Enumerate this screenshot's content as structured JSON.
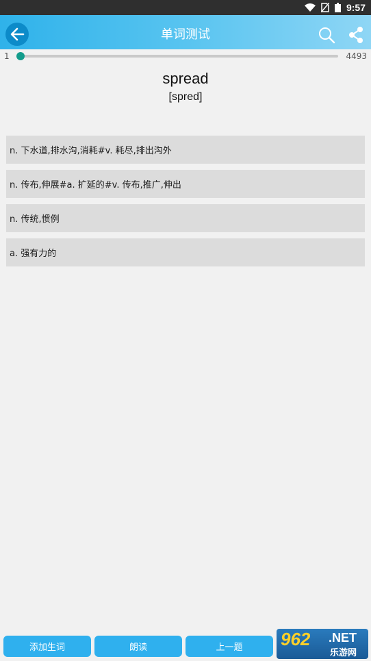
{
  "status_bar": {
    "time": "9:57"
  },
  "app_bar": {
    "title": "单词测试"
  },
  "progress": {
    "start_label": "1",
    "end_label": "4493",
    "current": 1,
    "total": 4493
  },
  "word": {
    "text": "spread",
    "phonetic": "[spred]"
  },
  "options": [
    {
      "text": "n. 下水道,排水沟,消耗#v. 耗尽,排出沟外"
    },
    {
      "text": "n. 传布,伸展#a. 扩延的#v. 传布,推广,伸出"
    },
    {
      "text": "n. 传统,惯例"
    },
    {
      "text": "a. 强有力的"
    }
  ],
  "bottom_buttons": {
    "add_word": "添加生词",
    "read_aloud": "朗读",
    "previous": "上一题"
  },
  "watermark": {
    "number": "962",
    "suffix": ".NET",
    "site": "乐游网"
  },
  "colors": {
    "accent": "#2fb0ee",
    "progress": "#139c8c",
    "app_bar_start": "#2fb2ea",
    "app_bar_end": "#8fd6f5"
  },
  "icons": [
    "wifi-icon",
    "no-sim-icon",
    "battery-icon",
    "arrow-left-icon",
    "search-icon",
    "share-icon"
  ]
}
